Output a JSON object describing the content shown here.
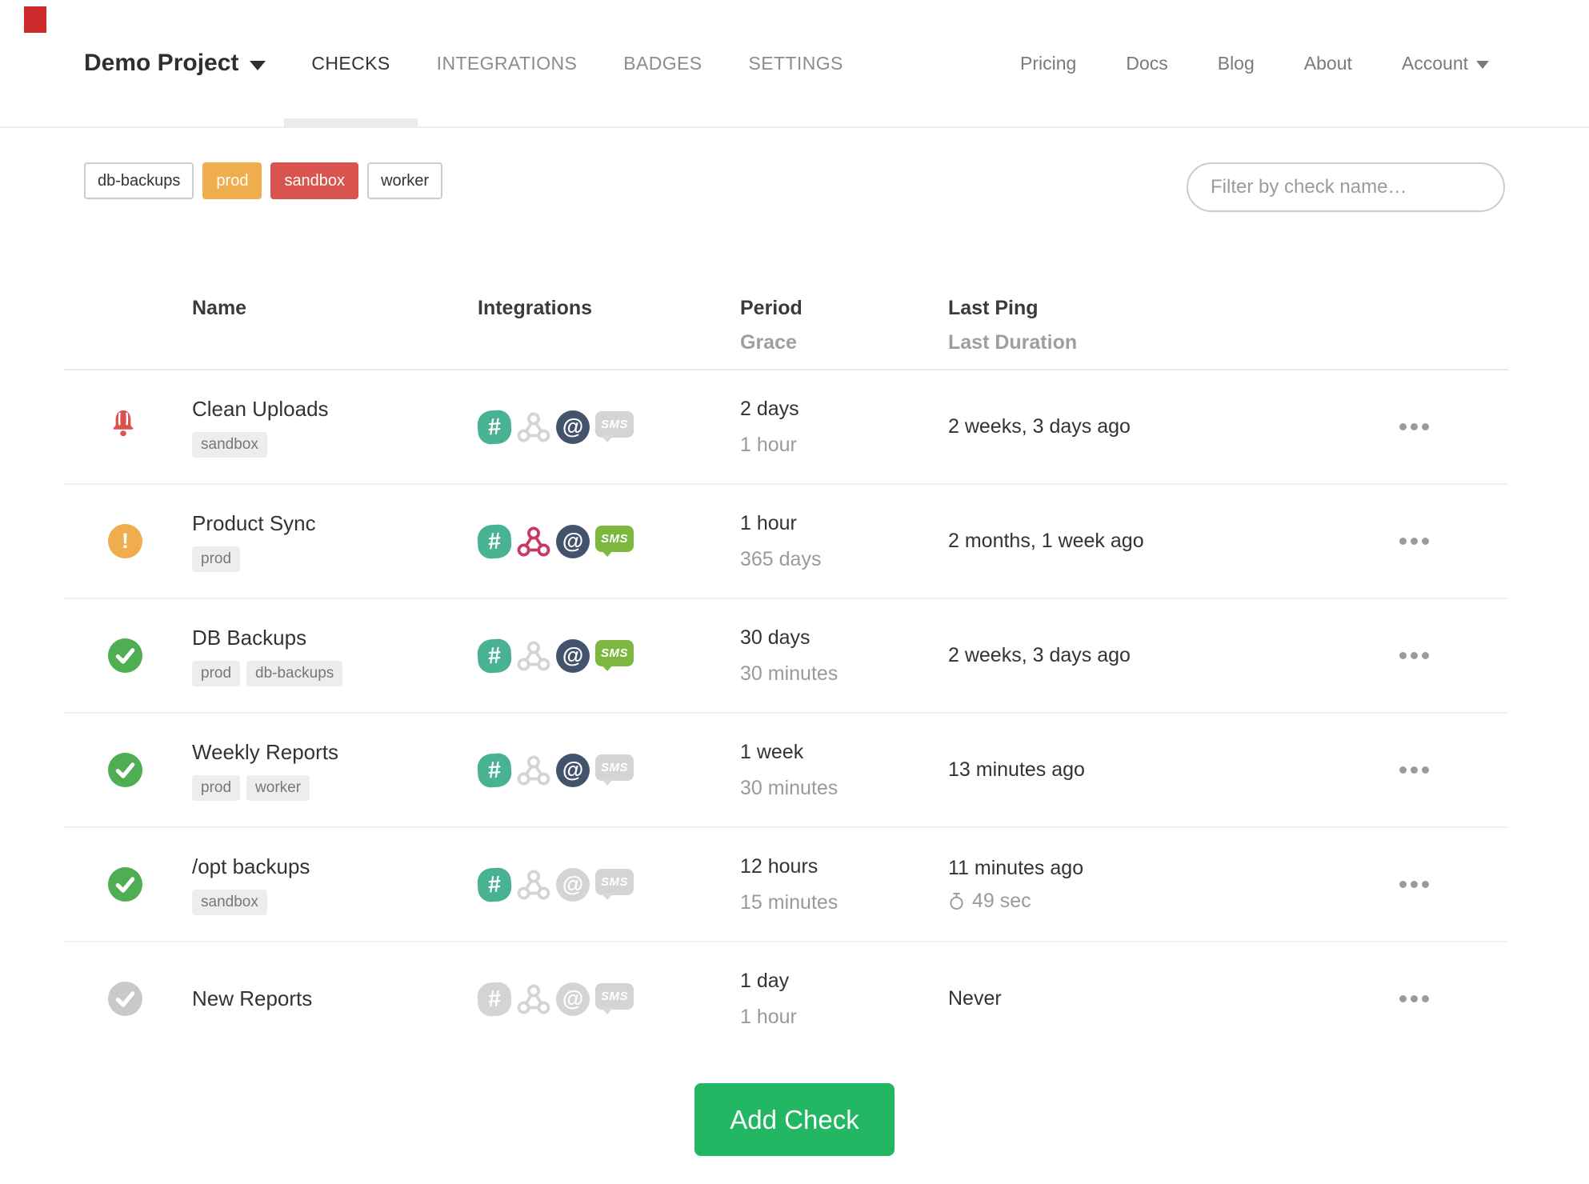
{
  "nav": {
    "project_name": "Demo Project",
    "tabs": [
      {
        "label": "CHECKS",
        "active": true
      },
      {
        "label": "INTEGRATIONS",
        "active": false
      },
      {
        "label": "BADGES",
        "active": false
      },
      {
        "label": "SETTINGS",
        "active": false
      }
    ],
    "links": [
      {
        "label": "Pricing"
      },
      {
        "label": "Docs"
      },
      {
        "label": "Blog"
      },
      {
        "label": "About"
      }
    ],
    "account_label": "Account"
  },
  "filters": {
    "tag_buttons": [
      {
        "label": "db-backups",
        "variant": "outline"
      },
      {
        "label": "prod",
        "variant": "warning"
      },
      {
        "label": "sandbox",
        "variant": "danger"
      },
      {
        "label": "worker",
        "variant": "outline"
      }
    ],
    "search_placeholder": "Filter by check name…"
  },
  "glyphs": {
    "slack": "#",
    "email": "@",
    "sms": "SMS"
  },
  "table": {
    "headers": {
      "name": "Name",
      "integrations": "Integrations",
      "period": "Period",
      "grace": "Grace",
      "last_ping": "Last Ping",
      "last_duration": "Last Duration"
    },
    "rows": [
      {
        "status": "alert",
        "name": "Clean Uploads",
        "tags": [
          "sandbox"
        ],
        "integrations": {
          "slack": true,
          "webhook": false,
          "email": true,
          "sms": false
        },
        "period": "2 days",
        "grace": "1 hour",
        "last_ping": "2 weeks, 3 days ago",
        "last_duration": null
      },
      {
        "status": "warning",
        "name": "Product Sync",
        "tags": [
          "prod"
        ],
        "integrations": {
          "slack": true,
          "webhook": true,
          "email": true,
          "sms": true
        },
        "period": "1 hour",
        "grace": "365 days",
        "last_ping": "2 months, 1 week ago",
        "last_duration": null
      },
      {
        "status": "up",
        "name": "DB Backups",
        "tags": [
          "prod",
          "db-backups"
        ],
        "integrations": {
          "slack": true,
          "webhook": false,
          "email": true,
          "sms": true
        },
        "period": "30 days",
        "grace": "30 minutes",
        "last_ping": "2 weeks, 3 days ago",
        "last_duration": null
      },
      {
        "status": "up",
        "name": "Weekly Reports",
        "tags": [
          "prod",
          "worker"
        ],
        "integrations": {
          "slack": true,
          "webhook": false,
          "email": true,
          "sms": false
        },
        "period": "1 week",
        "grace": "30 minutes",
        "last_ping": "13 minutes ago",
        "last_duration": null
      },
      {
        "status": "up",
        "name": "/opt backups",
        "tags": [
          "sandbox"
        ],
        "integrations": {
          "slack": true,
          "webhook": false,
          "email": false,
          "sms": false
        },
        "period": "12 hours",
        "grace": "15 minutes",
        "last_ping": "11 minutes ago",
        "last_duration": "49 sec"
      },
      {
        "status": "new",
        "name": "New Reports",
        "tags": [],
        "integrations": {
          "slack": false,
          "webhook": false,
          "email": false,
          "sms": false
        },
        "period": "1 day",
        "grace": "1 hour",
        "last_ping": "Never",
        "last_duration": null
      }
    ]
  },
  "footer": {
    "add_check_label": "Add Check"
  },
  "colors": {
    "brand_green": "#23b663",
    "ok_green": "#4fae51",
    "warning_orange": "#f0ad4e",
    "danger_red": "#d9534f",
    "slack_green": "#49b293",
    "webhook_crimson": "#c73a63",
    "email_navy": "#42536b",
    "sms_green": "#7cb740",
    "muted_gray": "#d4d4d4",
    "marker_red": "#cd2b2b"
  }
}
